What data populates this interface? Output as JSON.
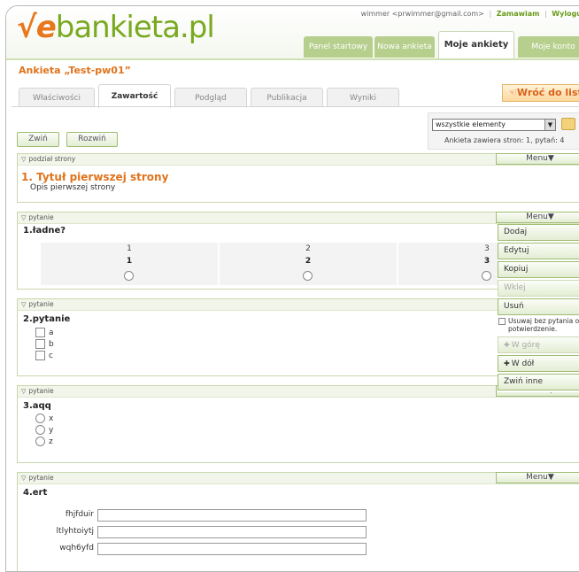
{
  "header": {
    "logo_w": "√",
    "logo_e": "e",
    "logo_rest": "bankieta.pl",
    "user_email": "wimmer <prwimmer@gmail.com>",
    "order_link": "Zamawiam",
    "logout_link": "Wylogu",
    "tabs": [
      "Panel startowy",
      "Nowa ankieta",
      "Moje ankiety",
      "Moje konto"
    ]
  },
  "survey": {
    "title": "Ankieta „Test-pw01”",
    "subtabs": [
      "Właściwości",
      "Zawartość",
      "Podgląd",
      "Publikacja",
      "Wyniki"
    ],
    "back_label": "Wróć do listy"
  },
  "toolbar": {
    "collapse_label": "Zwiń",
    "expand_label": "Rozwiń",
    "filter_value": "wszystkie elementy",
    "pages_info": "Ankieta zawiera stron: 1, pytań: 4"
  },
  "labels": {
    "menu": "Menu",
    "page_break": "podział strony",
    "question": "pytanie"
  },
  "page": {
    "title": "1. Tytuł pierwszej strony",
    "desc": "Opis pierwszej strony"
  },
  "questions": [
    {
      "title": "1.ładne?",
      "scale": [
        {
          "top": "1",
          "bottom": "1"
        },
        {
          "top": "2",
          "bottom": "2"
        },
        {
          "top": "3",
          "bottom": "3"
        }
      ]
    },
    {
      "title": "2.pytanie",
      "options": [
        "a",
        "b",
        "c"
      ]
    },
    {
      "title": "3.aqq",
      "options": [
        "x",
        "y",
        "z"
      ]
    },
    {
      "title": "4.ert",
      "fields": [
        "fhjfduir",
        "ltlyhtoiytj",
        "wqh6yfd"
      ]
    }
  ],
  "menu_dropdown": {
    "items": [
      "Dodaj",
      "Edytuj",
      "Kopiuj",
      "Wklej",
      "Usuń"
    ],
    "confirm_check": "Usuwaj bez pytania o potwierdzenie.",
    "move_up": "W górę",
    "move_down": "W dół",
    "collapse_others": "Zwiń inne"
  }
}
